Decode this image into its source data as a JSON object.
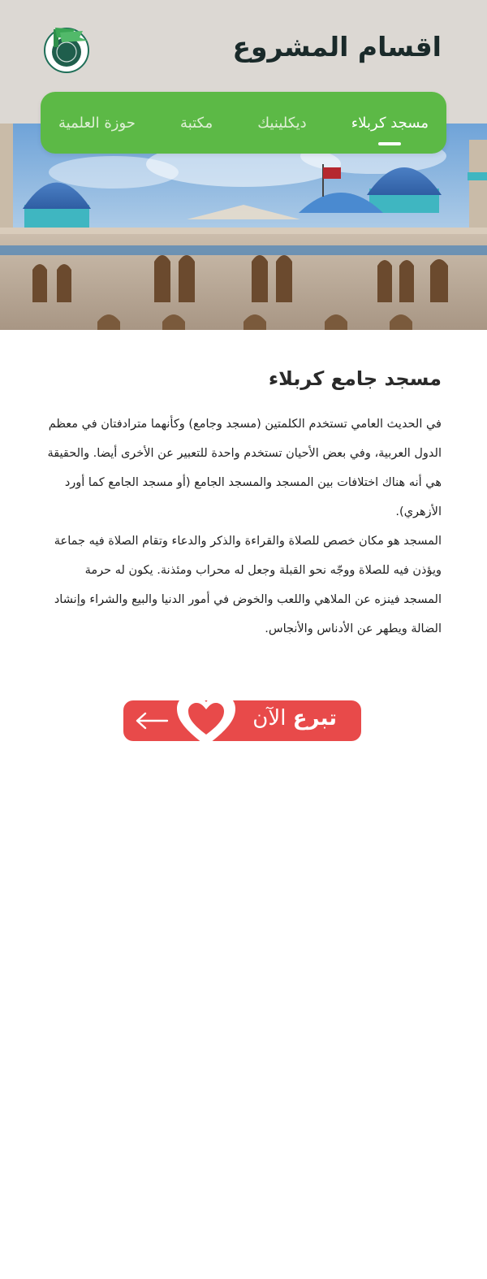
{
  "header": {
    "title": "اقسام المشروع",
    "logo_icon": "project-logo-icon"
  },
  "tabs": [
    {
      "label": "مسجد كربلاء",
      "active": true
    },
    {
      "label": "ديكلينيك",
      "active": false
    },
    {
      "label": "مكتبة",
      "active": false
    },
    {
      "label": "حوزة العلمية",
      "active": false
    }
  ],
  "hero": {
    "image": "mosque-building-image"
  },
  "article": {
    "title": "مسجد جامع كربلاء",
    "paragraph1": "في الحديث العامي تستخدم الكلمتين (مسجد وجامع) وكأنهما مترادفتان في معظم الدول العربية، وفي بعض الأحيان تستخدم واحدة للتعبير عن الأخرى أيضا. والحقيقة هي أنه هناك اختلافات بين المسجد والمسجد الجامع (أو مسجد الجامع كما أورد الأزهري).",
    "paragraph2": " المسجد هو مكان خصص للصلاة والقراءة والذكر والدعاء وتقام الصلاة فيه جماعة ويؤذن فيه للصلاة ووجّه نحو القبلة وجعل له محراب ومئذنة. يكون له حرمة المسجد فينزه عن الملاهي واللعب والخوض في أمور الدنيا والبيع والشراء وإنشاد الضالة ويطهر عن الأدناس والأنجاس."
  },
  "donate": {
    "label_bold": "تبرع",
    "label_light": "الآن",
    "heart_icon": "heart-icon",
    "arrow_icon": "arrow-left-icon"
  },
  "colors": {
    "green": "#5cb946",
    "red": "#e84a4a",
    "header_bg": "#dcd8d3"
  }
}
